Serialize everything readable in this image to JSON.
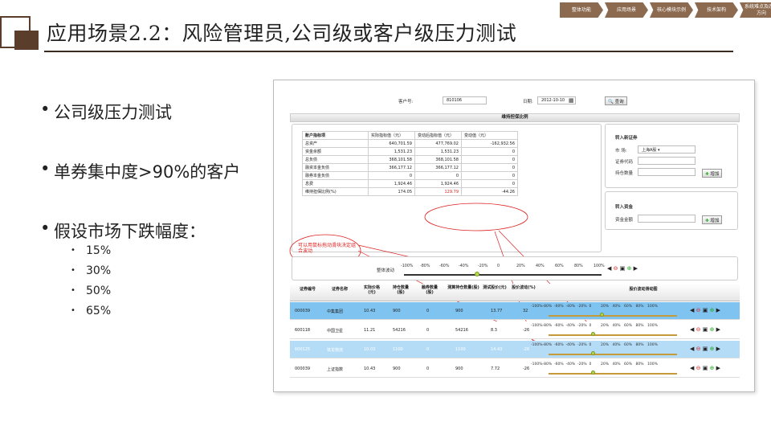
{
  "title": "应用场景2.2：风险管理员,公司级或客户级压力测试",
  "nav": [
    "整体功能",
    "应用场景",
    "核心模块示例",
    "技术架构",
    "系统难点及改进方向"
  ],
  "bullets": [
    "公司级压力测试",
    "单券集中度>90%的客户",
    "假设市场下跌幅度："
  ],
  "sub_bullets": [
    "15%",
    "30%",
    "50%",
    "65%"
  ],
  "screenshot": {
    "account_label": "客户号:",
    "account_value": "810106",
    "date_label": "日期:",
    "date_value": "2012-10-10",
    "query_button": "查询",
    "section_title": "维持担保比例",
    "metrics_header": [
      "账户指标项",
      "实际指标值（元）",
      "变动后指标值（元）",
      "变动值（元）"
    ],
    "metrics_rows": [
      [
        "总资产",
        "640,701.59",
        "477,769.02",
        "-162,932.56"
      ],
      [
        "资金余额",
        "1,531.23",
        "1,531.23",
        "0"
      ],
      [
        "总负债",
        "368,101.58",
        "368,101.58",
        "0"
      ],
      [
        "融资本金负债",
        "366,177.12",
        "366,177.12",
        "0"
      ],
      [
        "融券本金负债",
        "0",
        "0",
        "0"
      ],
      [
        "息费",
        "1,924.46",
        "1,924.46",
        "0"
      ],
      [
        "维持担保比例(%)",
        "174.05",
        "129.79",
        "-44.26"
      ]
    ],
    "import_security": {
      "title": "转入新证券",
      "market_label": "市  场:",
      "market_value": "上海A股",
      "code_label": "证券代码",
      "qty_label": "持仓数量",
      "add_label": "增加"
    },
    "import_fund": {
      "title": "转入资金",
      "amount_label": "资金金额",
      "add_label": "增加"
    },
    "annotation": "可以用鼠标拖动滑块决定组合波动",
    "overall_label": "整体波动",
    "slider_ticks": [
      "-100%",
      "-80%",
      "-60%",
      "-40%",
      "-20%",
      "0",
      "20%",
      "40%",
      "60%",
      "80%",
      "100%"
    ],
    "grid_header": [
      "证券编号",
      "证券名称",
      "实际价格(元)",
      "持仓数量(股)",
      "融券数量(股)",
      "测算持仓数量(股)",
      "测试股价(元)",
      "股价波动(%)",
      "股价波动滑动图"
    ],
    "grid_rows": [
      {
        "code": "000039",
        "name": "中集集团",
        "price": "10.43",
        "qty": "900",
        "short": "0",
        "calc_qty": "900",
        "test_price": "13.77",
        "change": "32"
      },
      {
        "code": "600118",
        "name": "中国卫星",
        "price": "11.21",
        "qty": "54216",
        "short": "0",
        "calc_qty": "54216",
        "test_price": "8.3",
        "change": "-26"
      },
      {
        "code": "600125",
        "name": "铁龙物流",
        "price": "10.03",
        "qty": "1100",
        "short": "0",
        "calc_qty": "1100",
        "test_price": "14.43",
        "change": "-26"
      },
      {
        "code": "000039",
        "name": "上证指数",
        "price": "10.43",
        "qty": "900",
        "short": "0",
        "calc_qty": "900",
        "test_price": "7.72",
        "change": "-26"
      }
    ],
    "colors": {
      "row_highlight": "#7fc3f0",
      "row_highlight2": "#b4dcf7",
      "annotation": "#dd2222",
      "brand": "#8b6a4f"
    }
  }
}
